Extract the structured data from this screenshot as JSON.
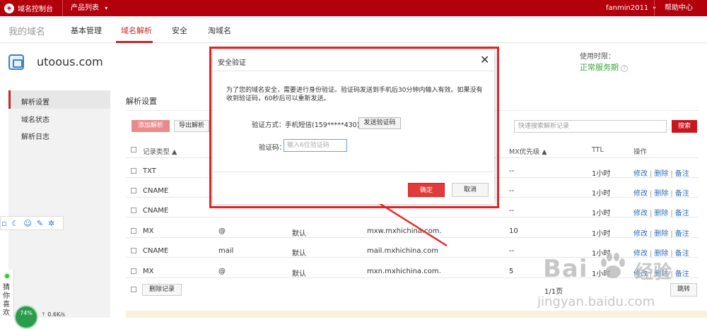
{
  "topbar": {
    "logo_text": "域名控制台",
    "product_list": "产品列表",
    "user": "fanmin2011",
    "help": "帮助中心"
  },
  "nav": {
    "my_domain": "我的域名",
    "tabs": [
      "基本管理",
      "域名解析",
      "安全",
      "淘域名"
    ],
    "active_tab": "域名解析"
  },
  "domain": {
    "name": "utoous.com",
    "usage_label": "使用时限：",
    "usage_status": "正常服务期"
  },
  "sidebar": {
    "items": [
      "解析设置",
      "域名状态",
      "解析日志"
    ]
  },
  "content": {
    "section_title": "解析设置",
    "add_button": "添加解析",
    "export_button": "导出解析",
    "search_placeholder": "快速搜索解析记录",
    "search_button": "搜索",
    "headers": {
      "record_type": "记录类型 ▲",
      "mx_priority": "MX优先级 ▲",
      "ttl": "TTL",
      "actions": "操作"
    },
    "rows": [
      {
        "type": "TXT",
        "host": "",
        "line": "",
        "value": "",
        "mx": "--",
        "ttl": "1小时"
      },
      {
        "type": "CNAME",
        "host": "",
        "line": "",
        "value": "",
        "mx": "--",
        "ttl": "1小时"
      },
      {
        "type": "CNAME",
        "host": "",
        "line": "",
        "value": "",
        "mx": "--",
        "ttl": "1小时"
      },
      {
        "type": "MX",
        "host": "@",
        "line": "默认",
        "value": "mxw.mxhichina.com.",
        "mx": "10",
        "ttl": "1小时"
      },
      {
        "type": "CNAME",
        "host": "mail",
        "line": "默认",
        "value": "mail.mxhichina.com",
        "mx": "--",
        "ttl": "1小时"
      },
      {
        "type": "MX",
        "host": "@",
        "line": "默认",
        "value": "mxn.mxhichina.com.",
        "mx": "5",
        "ttl": "1小时"
      }
    ],
    "action_edit": "修改",
    "action_delete": "删除",
    "action_note": "备注",
    "action_sep": "|",
    "delete_records": "删除记录",
    "page_info": "1/1页",
    "jump": "跳转"
  },
  "modal": {
    "title": "安全验证",
    "close": "✕",
    "description": "为了您的域名安全，需要进行身份验证。验证码发送到手机后30分钟内输入有效。如果没有收到验证码，60秒后可以重新发送。",
    "verify_label": "验证方式：",
    "verify_value": "手机短信(159*****430)",
    "send_code": "发送验证码",
    "code_label": "验证码：",
    "code_placeholder": "输入6位验证码",
    "ok": "确定",
    "cancel": "取消"
  },
  "widgets": {
    "guess_text": "猜你喜欢",
    "speed": "0.6K/s",
    "ball_value": "74%"
  },
  "watermark": {
    "brand": "Bai",
    "brand_suffix": "经验",
    "url": "jingyan.baidu.com"
  },
  "colors": {
    "topbar": "#b3000d",
    "accent": "#c1272d",
    "link": "#2f6db5",
    "status_green": "#3aa635",
    "highlight_frame": "#e8262b"
  }
}
